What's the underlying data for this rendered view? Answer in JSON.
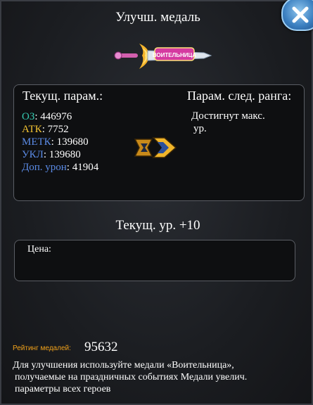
{
  "window": {
    "title": "Улучш. медаль"
  },
  "medal": {
    "banner_text": "ВОИТЕЛЬНИЦА"
  },
  "current": {
    "header": "Текущ. парам.:",
    "stats": [
      {
        "key": "ОЗ",
        "sep": ": ",
        "value": "446976",
        "color": "#35c9b0"
      },
      {
        "key": "АТК",
        "sep": ": ",
        "value": "7752",
        "color": "#f2c232"
      },
      {
        "key": "МЕТК",
        "sep": ": ",
        "value": "139680",
        "color": "#5b8be6"
      },
      {
        "key": "УКЛ",
        "sep": ": ",
        "value": "139680",
        "color": "#5b8be6"
      },
      {
        "key": "Доп. урон",
        "sep": ": ",
        "value": "41904",
        "color": "#5b8be6"
      }
    ]
  },
  "next": {
    "header": "Парам. след. ранга:",
    "line1": "Достигнут макс.",
    "line2": "ур."
  },
  "level_text": "Текущ. ур. +10",
  "price_label": "Цена:",
  "rating": {
    "label": "Рейтинг медалей:",
    "value": "95632"
  },
  "description": {
    "line1": "Для улучшения используйте медали «Воительница»,",
    "line2": "получаемые на праздничных событиях Медали увелич.",
    "line3": "параметры всех героев"
  },
  "colors": {
    "accent_gold": "#f2a21a",
    "close_blue": "#3b7fc0"
  }
}
